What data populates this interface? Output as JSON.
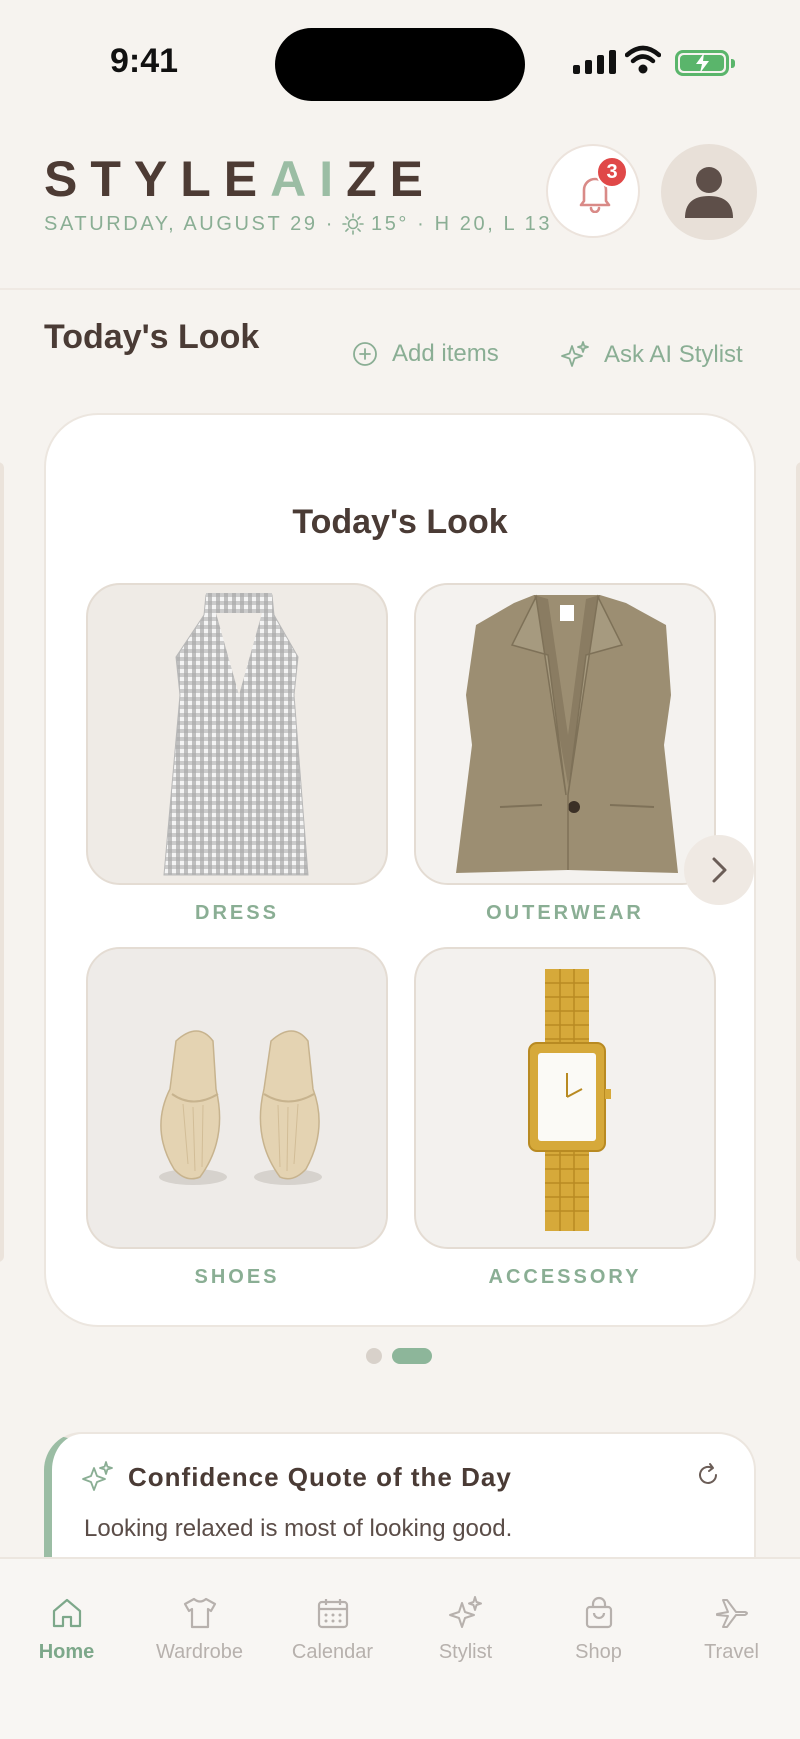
{
  "status_bar": {
    "time": "9:41"
  },
  "header": {
    "brand_prefix": "STYLE",
    "brand_ai": "AI",
    "brand_suffix": "ZE",
    "date": "SATURDAY, AUGUST 29 ·",
    "weather": "15° · H 20, L 13",
    "notification_count": "3"
  },
  "section": {
    "title": "Today's Look",
    "add_items": "Add items",
    "ask_ai": "Ask AI Stylist"
  },
  "card": {
    "title": "Today's Look",
    "items": [
      {
        "label": "DRESS",
        "icon": "dress-image"
      },
      {
        "label": "OUTERWEAR",
        "icon": "vest-image"
      },
      {
        "label": "SHOES",
        "icon": "shoes-image"
      },
      {
        "label": "ACCESSORY",
        "icon": "watch-image"
      }
    ],
    "pages": 2,
    "active_page": 2
  },
  "quote": {
    "title": "Confidence Quote of the Day",
    "text": "Looking relaxed is most of looking good."
  },
  "tabs": [
    {
      "label": "Home",
      "icon": "home-icon",
      "active": true
    },
    {
      "label": "Wardrobe",
      "icon": "shirt-icon",
      "active": false
    },
    {
      "label": "Calendar",
      "icon": "calendar-icon",
      "active": false
    },
    {
      "label": "Stylist",
      "icon": "sparkle-icon",
      "active": false
    },
    {
      "label": "Shop",
      "icon": "bag-icon",
      "active": false
    },
    {
      "label": "Travel",
      "icon": "plane-icon",
      "active": false
    }
  ],
  "colors": {
    "accent": "#8aae94",
    "brand_dark": "#4d3b34",
    "badge": "#e04848",
    "background": "#f6f3ef"
  }
}
